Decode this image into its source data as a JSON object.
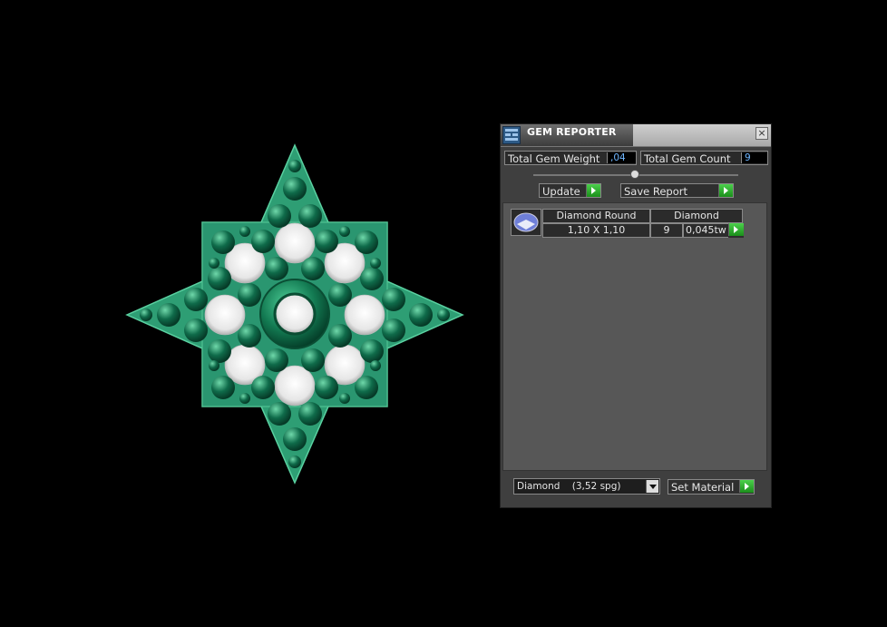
{
  "window": {
    "title": "GEM REPORTER",
    "close_glyph": "×"
  },
  "totals": {
    "weight_label": "Total Gem Weight",
    "weight_value": ",04",
    "count_label": "Total Gem Count",
    "count_value": "9"
  },
  "toolbar": {
    "update_label": "Update",
    "save_report_label": "Save Report"
  },
  "gem_list": [
    {
      "shape": "Diamond Round",
      "material": "Diamond",
      "size": "1,10 X 1,10",
      "count": "9",
      "weight": "0,045tw"
    }
  ],
  "material_select": {
    "selected": "Diamond    (3,52 spg)",
    "set_label": "Set Material"
  },
  "colors": {
    "metal": "#2e9e74",
    "sphere": "#0f6b4a",
    "arrow_green": "#2cb52c",
    "value_text": "#6fb6ff"
  },
  "icons": [
    "app-icon",
    "close-icon",
    "play-arrow-icon",
    "chevron-down-icon",
    "gem-thumbnail-icon"
  ]
}
